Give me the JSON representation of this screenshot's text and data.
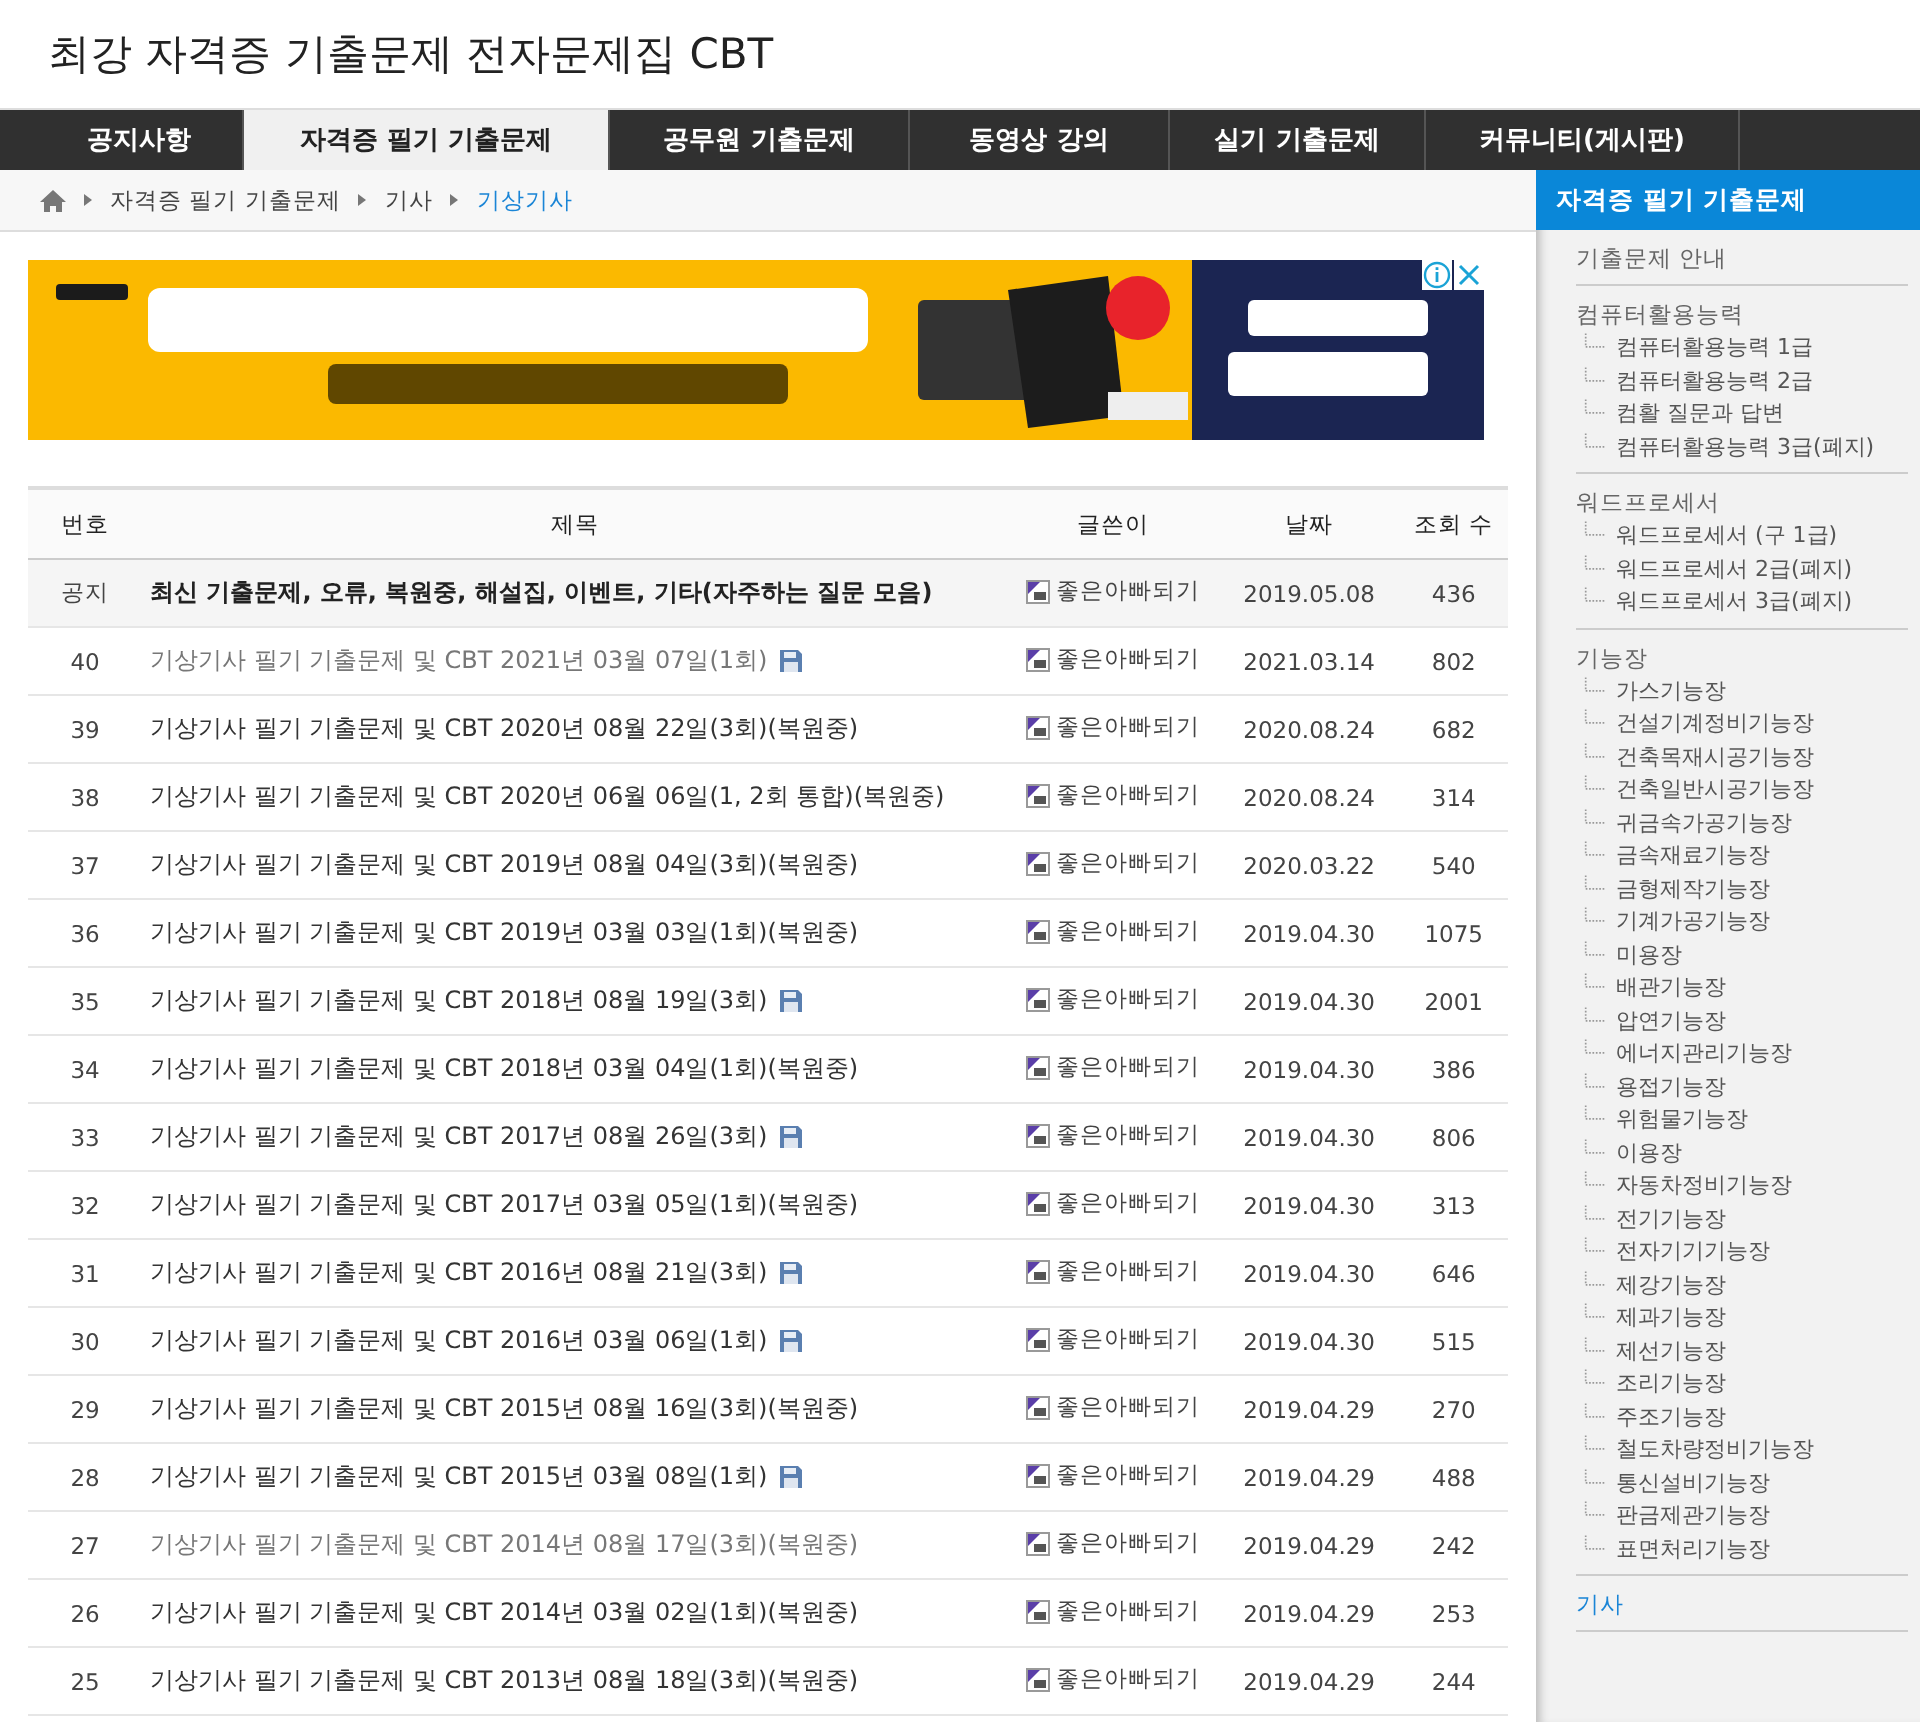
{
  "site_title": "최강 자격증 기출문제 전자문제집 CBT",
  "nav": [
    {
      "label": "공지사항",
      "selected": false
    },
    {
      "label": "자격증 필기 기출문제",
      "selected": true
    },
    {
      "label": "공무원 기출문제",
      "selected": false
    },
    {
      "label": "동영상 강의",
      "selected": false
    },
    {
      "label": "실기 기출문제",
      "selected": false
    },
    {
      "label": "커뮤니티(게시판)",
      "selected": false
    }
  ],
  "breadcrumb": [
    {
      "label": "자격증 필기 기출문제",
      "selected": false
    },
    {
      "label": "기사",
      "selected": false
    },
    {
      "label": "기상기사",
      "selected": true
    }
  ],
  "table": {
    "columns": [
      "번호",
      "제목",
      "글쓴이",
      "날짜",
      "조회 수"
    ],
    "rows": [
      {
        "no": "공지",
        "title": "최신 기출문제, 오류, 복원중, 해설집, 이벤트, 기타(자주하는 질문 모음)",
        "author": "좋은아빠되기",
        "date": "2019.05.08",
        "views": "436",
        "notice": true,
        "visited": false,
        "has_file": false
      },
      {
        "no": "40",
        "title": "기상기사 필기 기출문제 및 CBT 2021년 03월 07일(1회)",
        "author": "좋은아빠되기",
        "date": "2021.03.14",
        "views": "802",
        "notice": false,
        "visited": true,
        "has_file": true
      },
      {
        "no": "39",
        "title": "기상기사 필기 기출문제 및 CBT 2020년 08월 22일(3회)(복원중)",
        "author": "좋은아빠되기",
        "date": "2020.08.24",
        "views": "682",
        "notice": false,
        "visited": false,
        "has_file": false
      },
      {
        "no": "38",
        "title": "기상기사 필기 기출문제 및 CBT 2020년 06월 06일(1, 2회 통합)(복원중)",
        "author": "좋은아빠되기",
        "date": "2020.08.24",
        "views": "314",
        "notice": false,
        "visited": false,
        "has_file": false
      },
      {
        "no": "37",
        "title": "기상기사 필기 기출문제 및 CBT 2019년 08월 04일(3회)(복원중)",
        "author": "좋은아빠되기",
        "date": "2020.03.22",
        "views": "540",
        "notice": false,
        "visited": false,
        "has_file": false
      },
      {
        "no": "36",
        "title": "기상기사 필기 기출문제 및 CBT 2019년 03월 03일(1회)(복원중)",
        "author": "좋은아빠되기",
        "date": "2019.04.30",
        "views": "1075",
        "notice": false,
        "visited": false,
        "has_file": false
      },
      {
        "no": "35",
        "title": "기상기사 필기 기출문제 및 CBT 2018년 08월 19일(3회)",
        "author": "좋은아빠되기",
        "date": "2019.04.30",
        "views": "2001",
        "notice": false,
        "visited": false,
        "has_file": true
      },
      {
        "no": "34",
        "title": "기상기사 필기 기출문제 및 CBT 2018년 03월 04일(1회)(복원중)",
        "author": "좋은아빠되기",
        "date": "2019.04.30",
        "views": "386",
        "notice": false,
        "visited": false,
        "has_file": false
      },
      {
        "no": "33",
        "title": "기상기사 필기 기출문제 및 CBT 2017년 08월 26일(3회)",
        "author": "좋은아빠되기",
        "date": "2019.04.30",
        "views": "806",
        "notice": false,
        "visited": false,
        "has_file": true
      },
      {
        "no": "32",
        "title": "기상기사 필기 기출문제 및 CBT 2017년 03월 05일(1회)(복원중)",
        "author": "좋은아빠되기",
        "date": "2019.04.30",
        "views": "313",
        "notice": false,
        "visited": false,
        "has_file": false
      },
      {
        "no": "31",
        "title": "기상기사 필기 기출문제 및 CBT 2016년 08월 21일(3회)",
        "author": "좋은아빠되기",
        "date": "2019.04.30",
        "views": "646",
        "notice": false,
        "visited": false,
        "has_file": true
      },
      {
        "no": "30",
        "title": "기상기사 필기 기출문제 및 CBT 2016년 03월 06일(1회)",
        "author": "좋은아빠되기",
        "date": "2019.04.30",
        "views": "515",
        "notice": false,
        "visited": false,
        "has_file": true
      },
      {
        "no": "29",
        "title": "기상기사 필기 기출문제 및 CBT 2015년 08월 16일(3회)(복원중)",
        "author": "좋은아빠되기",
        "date": "2019.04.29",
        "views": "270",
        "notice": false,
        "visited": false,
        "has_file": false
      },
      {
        "no": "28",
        "title": "기상기사 필기 기출문제 및 CBT 2015년 03월 08일(1회)",
        "author": "좋은아빠되기",
        "date": "2019.04.29",
        "views": "488",
        "notice": false,
        "visited": false,
        "has_file": true
      },
      {
        "no": "27",
        "title": "기상기사 필기 기출문제 및 CBT 2014년 08월 17일(3회)(복원중)",
        "author": "좋은아빠되기",
        "date": "2019.04.29",
        "views": "242",
        "notice": false,
        "visited": true,
        "has_file": false
      },
      {
        "no": "26",
        "title": "기상기사 필기 기출문제 및 CBT 2014년 03월 02일(1회)(복원중)",
        "author": "좋은아빠되기",
        "date": "2019.04.29",
        "views": "253",
        "notice": false,
        "visited": false,
        "has_file": false
      },
      {
        "no": "25",
        "title": "기상기사 필기 기출문제 및 CBT 2013년 08월 18일(3회)(복원중)",
        "author": "좋은아빠되기",
        "date": "2019.04.29",
        "views": "244",
        "notice": false,
        "visited": false,
        "has_file": false
      }
    ]
  },
  "sidebar": {
    "title": "자격증 필기 기출문제",
    "groups": [
      {
        "label": "기출문제 안내",
        "selected": false
      },
      {
        "label": "컴퓨터활용능력",
        "selected": false,
        "children": [
          "컴퓨터활용능력 1급",
          "컴퓨터활용능력 2급",
          "컴활 질문과 답변",
          "컴퓨터활용능력 3급(폐지)"
        ]
      },
      {
        "label": "워드프로세서",
        "selected": false,
        "children": [
          "워드프로세서 (구 1급)",
          "워드프로세서 2급(폐지)",
          "워드프로세서 3급(폐지)"
        ]
      },
      {
        "label": "기능장",
        "selected": false,
        "children": [
          "가스기능장",
          "건설기계정비기능장",
          "건축목재시공기능장",
          "건축일반시공기능장",
          "귀금속가공기능장",
          "금속재료기능장",
          "금형제작기능장",
          "기계가공기능장",
          "미용장",
          "배관기능장",
          "압연기능장",
          "에너지관리기능장",
          "용접기능장",
          "위험물기능장",
          "이용장",
          "자동차정비기능장",
          "전기기능장",
          "전자기기기능장",
          "제강기능장",
          "제과기능장",
          "제선기능장",
          "조리기능장",
          "주조기능장",
          "철도차량정비기능장",
          "통신설비기능장",
          "판금제관기능장",
          "표면처리기능장"
        ]
      },
      {
        "label": "기사",
        "selected": true
      }
    ]
  }
}
